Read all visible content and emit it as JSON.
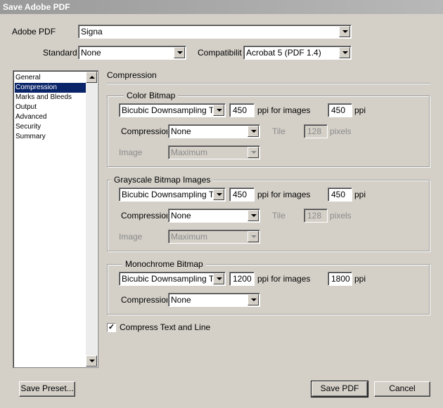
{
  "window": {
    "title": "Save Adobe PDF"
  },
  "top": {
    "preset_label": "Adobe PDF",
    "preset_value": "Signa",
    "standard_label": "Standard",
    "standard_value": "None",
    "compat_label": "Compatibilit",
    "compat_value": "Acrobat 5 (PDF 1.4)"
  },
  "sidebar": {
    "items": [
      {
        "label": "General"
      },
      {
        "label": "Compression",
        "selected": true
      },
      {
        "label": "Marks and Bleeds"
      },
      {
        "label": "Output"
      },
      {
        "label": "Advanced"
      },
      {
        "label": "Security"
      },
      {
        "label": "Summary"
      }
    ]
  },
  "section": {
    "title": "Compression"
  },
  "color": {
    "title": "Color Bitmap",
    "downsample_value": "Bicubic Downsampling To",
    "ppi_value": "450",
    "ppi_for_images_label": "ppi for images",
    "above_value": "450",
    "ppi_label": "ppi",
    "compression_label": "Compression",
    "compression_value": "None",
    "tile_label": "Tile",
    "tile_value": "128",
    "pixels_label": "pixels",
    "image_label": "Image",
    "image_value": "Maximum"
  },
  "gray": {
    "title": "Grayscale Bitmap Images",
    "downsample_value": "Bicubic Downsampling To",
    "ppi_value": "450",
    "ppi_for_images_label": "ppi for images",
    "above_value": "450",
    "ppi_label": "ppi",
    "compression_label": "Compression",
    "compression_value": "None",
    "tile_label": "Tile",
    "tile_value": "128",
    "pixels_label": "pixels",
    "image_label": "Image",
    "image_value": "Maximum"
  },
  "mono": {
    "title": "Monochrome Bitmap",
    "downsample_value": "Bicubic Downsampling To",
    "ppi_value": "1200",
    "ppi_for_images_label": "ppi for images",
    "above_value": "1800",
    "ppi_label": "ppi",
    "compression_label": "Compression",
    "compression_value": "None"
  },
  "compress_text": {
    "label": "Compress Text and Line A",
    "checked": true,
    "mark": "✓"
  },
  "buttons": {
    "save_preset": "Save Preset...",
    "save_pdf": "Save PDF",
    "cancel": "Cancel"
  }
}
